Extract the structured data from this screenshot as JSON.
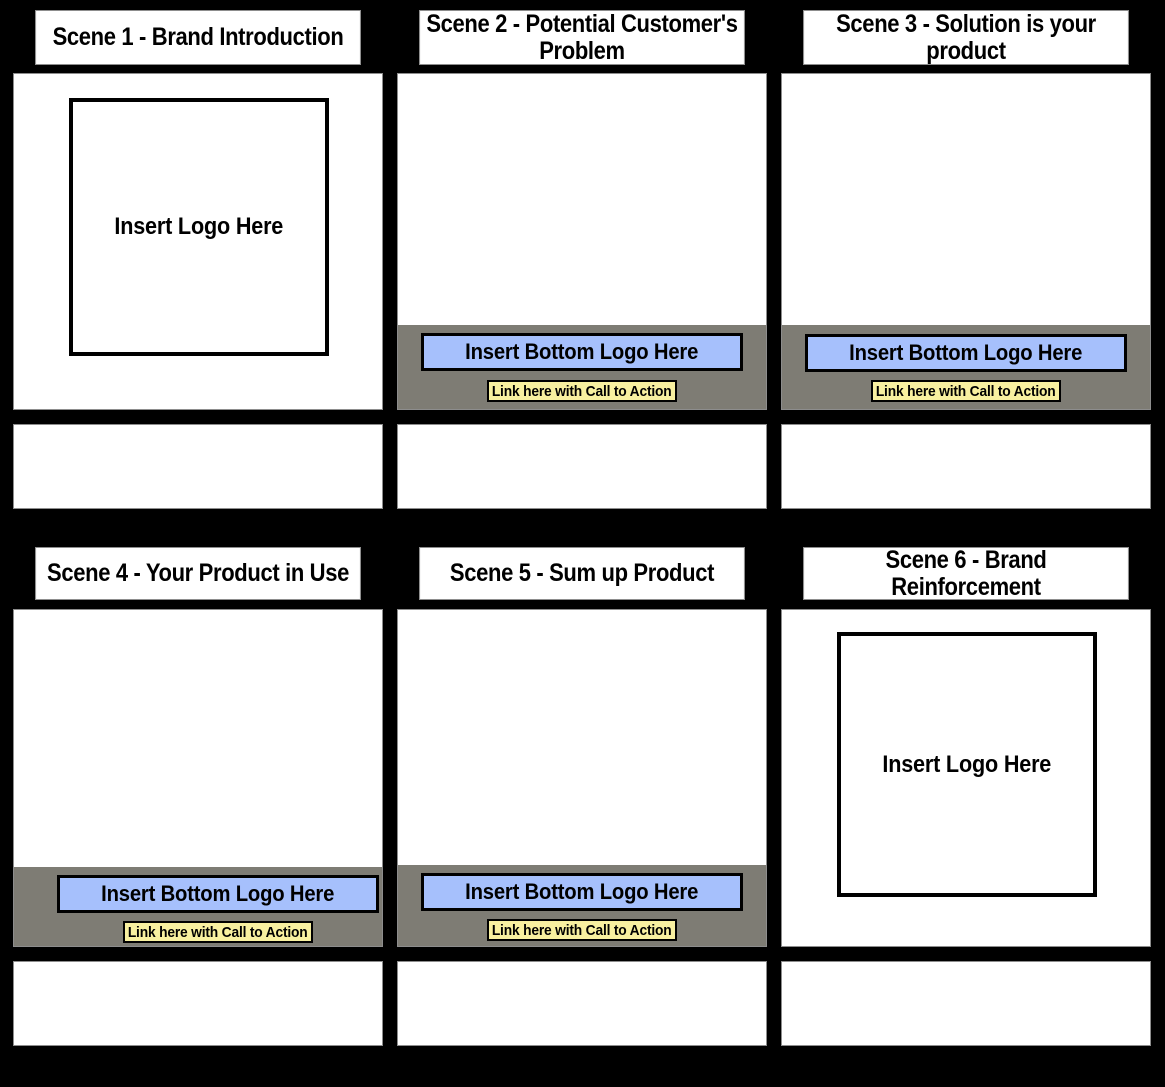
{
  "board": {
    "background_color": "#000000",
    "title_bar_color": "#ffffff",
    "canvas_color": "#ffffff",
    "strip_color": "#7e7c74",
    "bottom_logo_color": "#a6c0fc",
    "cta_color": "#f8f0a0",
    "border_color": "#8d8d8d"
  },
  "labels": {
    "logo_placeholder": "Insert Logo Here",
    "bottom_logo_placeholder": "Insert  Bottom Logo Here",
    "cta_placeholder": "Link here with Call to Action"
  },
  "scenes": [
    {
      "id": "scene-1",
      "title": "Scene 1 - Brand Introduction",
      "has_logo_box": true,
      "has_bottom_strip": false,
      "logo_text": "Insert Logo Here"
    },
    {
      "id": "scene-2",
      "title": "Scene 2 - Potential Customer's\nProblem",
      "has_logo_box": false,
      "has_bottom_strip": true,
      "bottom_logo_text": "Insert  Bottom Logo Here",
      "cta_text": "Link here with Call to Action"
    },
    {
      "id": "scene-3",
      "title": "Scene 3 - Solution is your product",
      "has_logo_box": false,
      "has_bottom_strip": true,
      "bottom_logo_text": "Insert  Bottom Logo Here",
      "cta_text": "Link here with Call to Action"
    },
    {
      "id": "scene-4",
      "title": "Scene 4 - Your Product in Use",
      "has_logo_box": false,
      "has_bottom_strip": true,
      "bottom_logo_text": "Insert  Bottom Logo Here",
      "cta_text": "Link here with Call to Action"
    },
    {
      "id": "scene-5",
      "title": "Scene 5 - Sum up Product",
      "has_logo_box": false,
      "has_bottom_strip": true,
      "bottom_logo_text": "Insert  Bottom Logo Here",
      "cta_text": "Link here with Call to Action"
    },
    {
      "id": "scene-6",
      "title": "Scene 6 - Brand Reinforcement",
      "has_logo_box": true,
      "has_bottom_strip": false,
      "logo_text": "Insert Logo Here"
    }
  ],
  "notes": [
    {
      "id": "notes-1",
      "text": ""
    },
    {
      "id": "notes-2",
      "text": ""
    },
    {
      "id": "notes-3",
      "text": ""
    },
    {
      "id": "notes-4",
      "text": ""
    },
    {
      "id": "notes-5",
      "text": ""
    },
    {
      "id": "notes-6",
      "text": ""
    }
  ]
}
